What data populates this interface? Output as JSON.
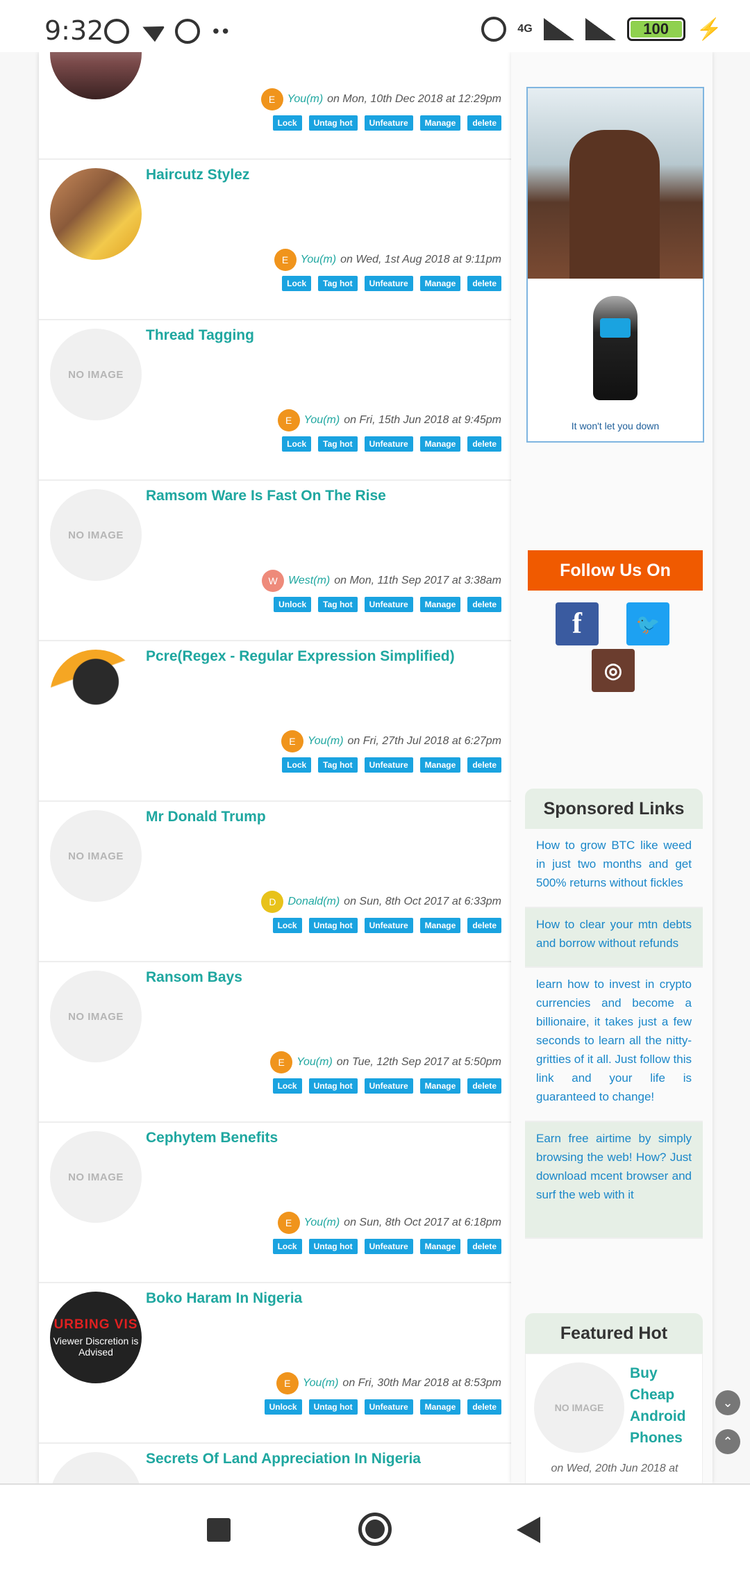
{
  "status_bar": {
    "time": "9:32",
    "dots": "••",
    "network": "4G",
    "battery": "100"
  },
  "threads": [
    {
      "title": "",
      "avatar_letter": "E",
      "avatar_color": "#f0941c",
      "user": "You(m)",
      "date": "on Mon, 10th Dec 2018 at 12:29pm",
      "actions": [
        "Lock",
        "Untag hot",
        "Unfeature",
        "Manage",
        "delete"
      ],
      "image": "photo"
    },
    {
      "title": "Haircutz Stylez",
      "avatar_letter": "E",
      "avatar_color": "#f0941c",
      "user": "You(m)",
      "date": "on Wed, 1st Aug 2018 at 9:11pm",
      "actions": [
        "Lock",
        "Tag hot",
        "Unfeature",
        "Manage",
        "delete"
      ],
      "image": "photo"
    },
    {
      "title": "Thread Tagging",
      "avatar_letter": "E",
      "avatar_color": "#f0941c",
      "user": "You(m)",
      "date": "on Fri, 15th Jun 2018 at 9:45pm",
      "actions": [
        "Lock",
        "Tag hot",
        "Unfeature",
        "Manage",
        "delete"
      ],
      "image": "NO IMAGE"
    },
    {
      "title": "Ramsom Ware Is Fast On The Rise",
      "avatar_letter": "W",
      "avatar_color": "#ee8a7a",
      "user": "West(m)",
      "date": "on Mon, 11th Sep 2017 at 3:38am",
      "actions": [
        "Unlock",
        "Tag hot",
        "Unfeature",
        "Manage",
        "delete"
      ],
      "image": "NO IMAGE"
    },
    {
      "title": "Pcre(Regex - Regular Expression Simplified)",
      "avatar_letter": "E",
      "avatar_color": "#f0941c",
      "user": "You(m)",
      "date": "on Fri, 27th Jul 2018 at 6:27pm",
      "actions": [
        "Lock",
        "Tag hot",
        "Unfeature",
        "Manage",
        "delete"
      ],
      "image": "photo"
    },
    {
      "title": "Mr Donald Trump",
      "avatar_letter": "D",
      "avatar_color": "#e8c21a",
      "user": "Donald(m)",
      "date": "on Sun, 8th Oct 2017 at 6:33pm",
      "actions": [
        "Lock",
        "Untag hot",
        "Unfeature",
        "Manage",
        "delete"
      ],
      "image": "NO IMAGE"
    },
    {
      "title": "Ransom Bays",
      "avatar_letter": "E",
      "avatar_color": "#f0941c",
      "user": "You(m)",
      "date": "on Tue, 12th Sep 2017 at 5:50pm",
      "actions": [
        "Lock",
        "Untag hot",
        "Unfeature",
        "Manage",
        "delete"
      ],
      "image": "NO IMAGE"
    },
    {
      "title": "Cephytem Benefits",
      "avatar_letter": "E",
      "avatar_color": "#f0941c",
      "user": "You(m)",
      "date": "on Sun, 8th Oct 2017 at 6:18pm",
      "actions": [
        "Lock",
        "Untag hot",
        "Unfeature",
        "Manage",
        "delete"
      ],
      "image": "NO IMAGE"
    },
    {
      "title": "Boko Haram In Nigeria",
      "avatar_letter": "E",
      "avatar_color": "#f0941c",
      "user": "You(m)",
      "date": "on Fri, 30th Mar 2018 at 8:53pm",
      "actions": [
        "Unlock",
        "Untag hot",
        "Unfeature",
        "Manage",
        "delete"
      ],
      "image": "warning"
    },
    {
      "title": "Secrets Of Land Appreciation In Nigeria",
      "avatar_letter": "",
      "avatar_color": "",
      "user": "",
      "date": "",
      "actions": [],
      "image": "NO IMAGE"
    }
  ],
  "no_image_label": "NO IMAGE",
  "thumb_texts": {
    "warning_top": "URBING VIS",
    "warning_bottom": "Viewer Discretion is Advised"
  },
  "ad": {
    "caption": "It won't let you down"
  },
  "follow": {
    "heading": "Follow Us On",
    "facebook": "f",
    "twitter": "t",
    "instagram": "ig"
  },
  "sponsored": {
    "heading": "Sponsored Links",
    "links": [
      "How to grow BTC like weed in just two months and get 500% returns without fickles",
      "How to clear your mtn debts and borrow without refunds",
      "learn how to invest in crypto currencies and become a billionaire, it takes just a few seconds to learn all the nitty-gritties of it all. Just follow this link and your life is guaranteed to change!",
      "Earn free airtime by simply browsing the web! How? Just download mcent browser and surf the web with it"
    ]
  },
  "featured": {
    "heading": "Featured Hot",
    "title": "Buy Cheap Android Phones",
    "thumb": "NO IMAGE",
    "date": "on Wed, 20th Jun 2018 at"
  }
}
